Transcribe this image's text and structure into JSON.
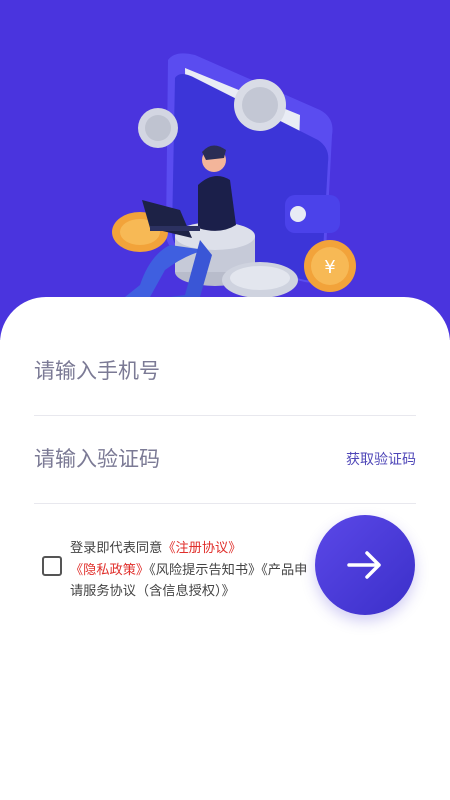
{
  "login": {
    "phone_placeholder": "请输入手机号",
    "code_placeholder": "请输入验证码",
    "get_code_label": "获取验证码",
    "agreement": {
      "prefix": "登录即代表同意",
      "register_link": "《注册协议》",
      "privacy_link": "《隐私政策》",
      "risk_link": "《风险提示告知书》",
      "service_link": "《产品申请服务协议（含信息授权）》"
    }
  },
  "colors": {
    "hero_bg": "#4a34de",
    "link_red": "#e0302c",
    "accent": "#4f47b8"
  },
  "icons": {
    "submit": "arrow-right-icon",
    "illustration": "wallet-man-coins-illustration"
  }
}
